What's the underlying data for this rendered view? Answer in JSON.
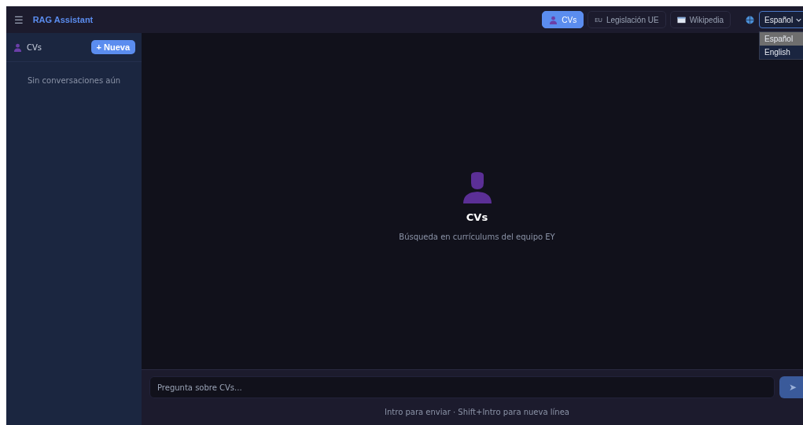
{
  "header": {
    "menu_icon": "☰",
    "title": "RAG Assistant"
  },
  "tabs": [
    {
      "label": "CVs",
      "kind": "person",
      "selected": true
    },
    {
      "label": "Legislación UE",
      "kind": "badge",
      "badge": "EU",
      "selected": false
    },
    {
      "label": "Wikipedia",
      "kind": "book",
      "selected": false
    }
  ],
  "language": {
    "value": "Español",
    "expanded": true,
    "options": [
      {
        "label": "Español",
        "selected": true
      },
      {
        "label": "English",
        "selected": false
      }
    ]
  },
  "sidebar": {
    "title": "CVs",
    "new_button": "+ Nueva",
    "empty": "Sin conversaciones aún"
  },
  "welcome": {
    "title": "CVs",
    "subtitle": "Búsqueda en currículums del equipo EY"
  },
  "composer": {
    "placeholder": "Pregunta sobre CVs...",
    "send": "➤",
    "hint": "Intro para enviar · Shift+Intro para nueva línea"
  }
}
